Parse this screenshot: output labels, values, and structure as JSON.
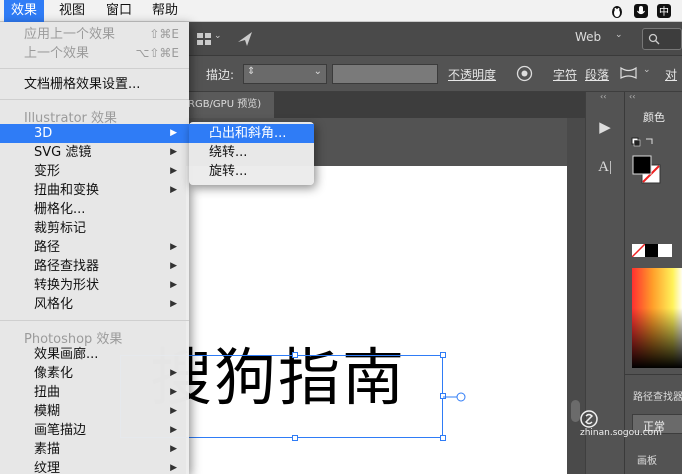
{
  "menubar": {
    "items": [
      {
        "label": "效果",
        "active": true
      },
      {
        "label": "视图"
      },
      {
        "label": "窗口"
      },
      {
        "label": "帮助"
      }
    ],
    "tray_icons": [
      "penguin-icon",
      "microphone-icon",
      "keyboard-input-icon"
    ]
  },
  "apptool": {
    "workspace_label": "Web"
  },
  "control_bar": {
    "stroke_label": "描边:",
    "opacity_label": "不透明度",
    "char_label": "字符",
    "para_label": "段落",
    "align_label": "对"
  },
  "document_tab": {
    "label": "RGB/GPU 预览)"
  },
  "effect_menu": {
    "apply_last": {
      "label": "应用上一个效果",
      "shortcut": "⇧⌘E"
    },
    "last_effect": {
      "label": "上一个效果",
      "shortcut": "⌥⇧⌘E"
    },
    "raster_settings": "文档栅格效果设置...",
    "illustrator_header": "Illustrator 效果",
    "illustrator_items": [
      "3D",
      "SVG 滤镜",
      "变形",
      "扭曲和变换",
      "栅格化...",
      "裁剪标记",
      "路径",
      "路径查找器",
      "转换为形状",
      "风格化"
    ],
    "photoshop_header": "Photoshop 效果",
    "photoshop_items": [
      "效果画廊...",
      "像素化",
      "扭曲",
      "模糊",
      "画笔描边",
      "素描",
      "纹理"
    ]
  },
  "submenu_3d": {
    "items": [
      "凸出和斜角...",
      "绕转...",
      "旋转..."
    ]
  },
  "canvas": {
    "text": "搜狗指南"
  },
  "color_panel": {
    "tab_label": "颜色",
    "pathfinder_label": "路径查找器",
    "blend_mode": "正常",
    "bottom_tab": "画板"
  },
  "watermark": {
    "site": "zhinan.sogou.com"
  },
  "colors": {
    "accent": "#2f7cf6",
    "menu_bg": "#ececec",
    "app_bg": "#535353"
  }
}
